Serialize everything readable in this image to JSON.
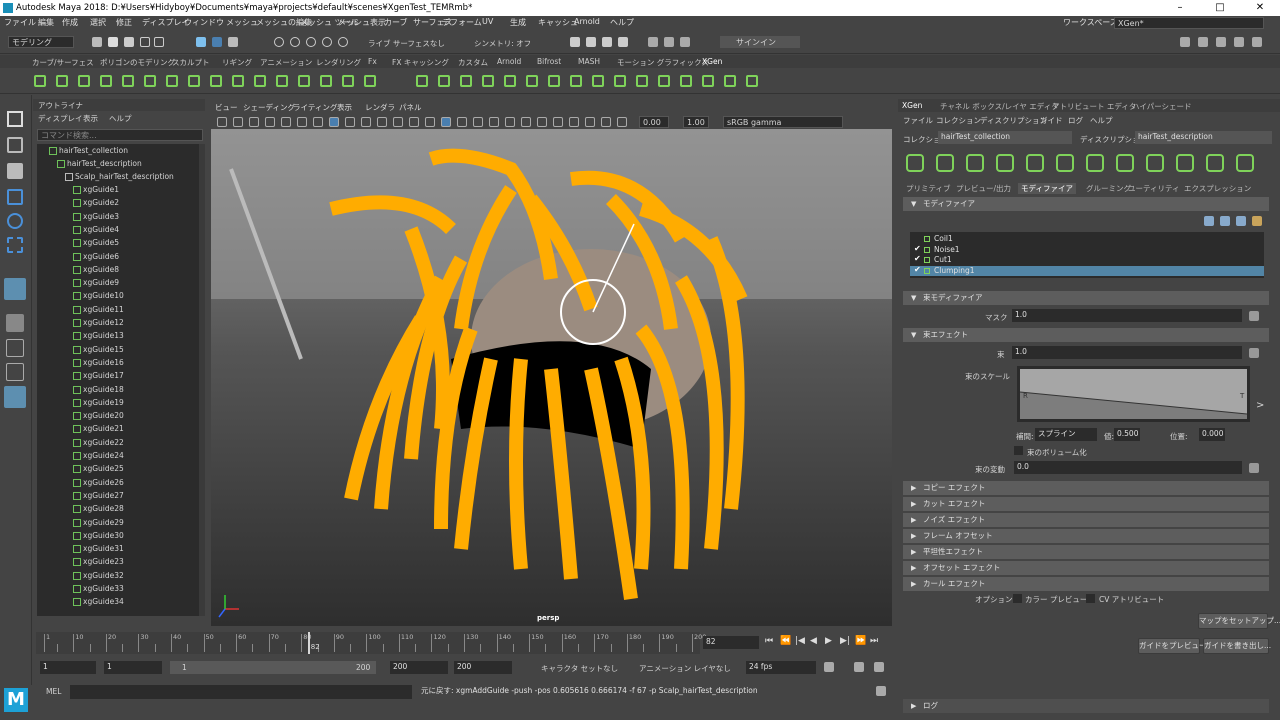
{
  "window": {
    "title": "Autodesk Maya 2018: D:¥Users¥Hidyboy¥Documents¥maya¥projects¥default¥scenes¥XgenTest_TEMRmb*"
  },
  "menu": [
    "ファイル",
    "編集",
    "作成",
    "選択",
    "修正",
    "ディスプレイ",
    "ウィンドウ",
    "メッシュ",
    "メッシュの編集",
    "メッシュ ツール",
    "メッシュ表示",
    "カーブ",
    "サーフェス",
    "デフォーム",
    "UV",
    "生成",
    "キャッシュ",
    "Arnold",
    "ヘルプ"
  ],
  "workspace": {
    "label": "ワークスペース :",
    "value": "XGen*"
  },
  "status_line": {
    "mode": "モデリング",
    "live": "ライブ サーフェスなし",
    "symmetry": "シンメトリ: オフ",
    "signin": "サインイン"
  },
  "shelf_tabs": [
    "カーブ/サーフェス",
    "ポリゴンのモデリング",
    "スカルプト",
    "リギング",
    "アニメーション",
    "レンダリング",
    "Fx",
    "FX キャッシング",
    "カスタム",
    "Arnold",
    "Bifrost",
    "MASH",
    "モーション グラフィックス",
    "XGen"
  ],
  "outliner": {
    "title": "アウトライナ",
    "menu": [
      "ディスプレイ",
      "表示",
      "ヘルプ"
    ],
    "search_placeholder": "コマンド検索...",
    "collection": "hairTest_collection",
    "description": "hairTest_description",
    "scalp": "Scalp_hairTest_description",
    "guides": [
      "xgGuide1",
      "xgGuide2",
      "xgGuide3",
      "xgGuide4",
      "xgGuide5",
      "xgGuide6",
      "xgGuide8",
      "xgGuide9",
      "xgGuide10",
      "xgGuide11",
      "xgGuide12",
      "xgGuide13",
      "xgGuide15",
      "xgGuide16",
      "xgGuide17",
      "xgGuide18",
      "xgGuide19",
      "xgGuide20",
      "xgGuide21",
      "xgGuide22",
      "xgGuide24",
      "xgGuide25",
      "xgGuide26",
      "xgGuide27",
      "xgGuide28",
      "xgGuide29",
      "xgGuide30",
      "xgGuide31",
      "xgGuide23",
      "xgGuide32",
      "xgGuide33",
      "xgGuide34"
    ]
  },
  "viewport": {
    "menu": [
      "ビュー",
      "シェーディング",
      "ライティング",
      "表示",
      "レンダラ",
      "パネル"
    ],
    "exposure": "0.00",
    "gamma": "1.00",
    "colorspace": "sRGB gamma",
    "camera_label": "persp"
  },
  "xgen": {
    "tabs": [
      "XGen",
      "チャネル ボックス/レイヤ エディタ",
      "アトリビュート エディタ",
      "ハイパーシェード"
    ],
    "menu": [
      "ファイル",
      "コレクション",
      "ディスクリプション",
      "ガイド",
      "ログ",
      "ヘルプ"
    ],
    "collection_label": "コレクション",
    "collection_value": "hairTest_collection",
    "description_label": "ディスクリプション",
    "description_value": "hairTest_description",
    "subtabs": [
      "プリミティブ",
      "プレビュー/出力",
      "モディファイア",
      "グルーミング",
      "ユーティリティ",
      "エクスプレッション"
    ],
    "modifier_header": "モディファイア",
    "modifiers": [
      "Coil1",
      "Noise1",
      "Cut1",
      "Clumping1"
    ],
    "clump_header": "束モディファイア",
    "mask_label": "マスク",
    "mask_value": "1.0",
    "clump_effect_header": "束エフェクト",
    "clump_label": "束",
    "clump_value": "1.0",
    "scale_label": "束のスケール",
    "ramp_left": "R",
    "ramp_right": "T",
    "interp_label": "補間:",
    "interp_value": "スプライン",
    "value_label": "値:",
    "value_value": "0.500",
    "position_label": "位置:",
    "position_value": "0.000",
    "volume_label": "束のボリューム化",
    "variance_label": "束の変動",
    "variance_value": "0.0",
    "sections": [
      "コピー エフェクト",
      "カット エフェクト",
      "ノイズ エフェクト",
      "フレーム オフセット",
      "平坦性エフェクト",
      "オフセット エフェクト",
      "カール エフェクト"
    ],
    "option_label": "オプション",
    "color_preview": "カラー プレビュー",
    "cv_attr": "CV アトリビュート",
    "map_btn": "マップをセットアップ...",
    "preview_btn": "ガイドをプレビュー",
    "write_btn": "ガイドを書き出し...",
    "log_header": "ログ"
  },
  "timeline": {
    "ticks": [
      "1",
      "10",
      "20",
      "30",
      "40",
      "50",
      "60",
      "70",
      "80",
      "90",
      "100",
      "110",
      "120",
      "130",
      "140",
      "150",
      "160",
      "170",
      "180",
      "190",
      "200"
    ],
    "current": "82",
    "current_field": "82"
  },
  "range": {
    "start": "1",
    "start2": "1",
    "slider_start": "1",
    "slider_end": "200",
    "end": "200",
    "end2": "200",
    "character": "キャラクタ セットなし",
    "anim_layer": "アニメーション レイヤなし",
    "fps": "24 fps"
  },
  "command": {
    "mel": "MEL",
    "result": "元に戻す: xgmAddGuide -push -pos 0.605616 0.666174 -f 67 -p Scalp_hairTest_description"
  }
}
